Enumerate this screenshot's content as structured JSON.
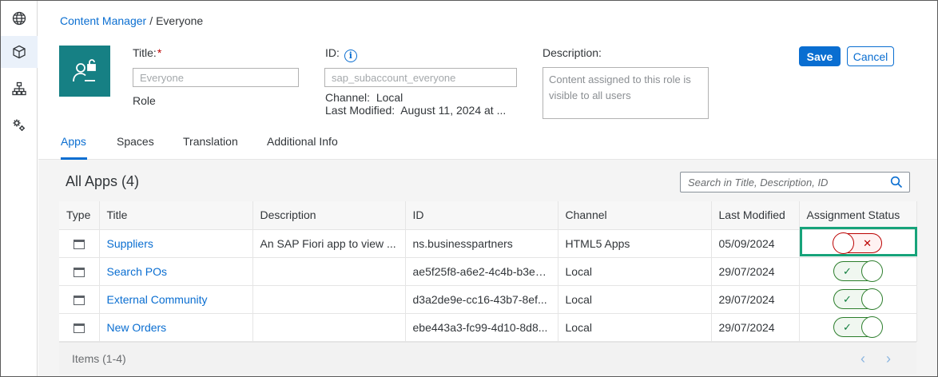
{
  "breadcrumb": {
    "parent": "Content Manager",
    "separator": "/",
    "current": "Everyone"
  },
  "header": {
    "title_label": "Title:",
    "required_mark": "*",
    "title_value": "Everyone",
    "role_label": "Role",
    "id_label": "ID:",
    "id_value": "sap_subaccount_everyone",
    "channel_label": "Channel:",
    "channel_value": "Local",
    "last_modified_label": "Last Modified:",
    "last_modified_value": "August 11, 2024 at ...",
    "description_label": "Description:",
    "description_value": "Content assigned to this role is visible to all users",
    "save_label": "Save",
    "cancel_label": "Cancel"
  },
  "tabs": [
    {
      "label": "Apps",
      "active": true
    },
    {
      "label": "Spaces"
    },
    {
      "label": "Translation"
    },
    {
      "label": "Additional Info"
    }
  ],
  "apps": {
    "title": "All Apps (4)",
    "search_placeholder": "Search in Title, Description, ID",
    "columns": [
      "Type",
      "Title",
      "Description",
      "ID",
      "Channel",
      "Last Modified",
      "Assignment Status"
    ],
    "rows": [
      {
        "title": "Suppliers",
        "description": "An SAP Fiori app to view ...",
        "id": "ns.businesspartners",
        "channel": "HTML5 Apps",
        "last_modified": "05/09/2024",
        "assigned": false
      },
      {
        "title": "Search POs",
        "description": "",
        "id": "ae5f25f8-a6e2-4c4b-b3e5...",
        "channel": "Local",
        "last_modified": "29/07/2024",
        "assigned": true
      },
      {
        "title": "External Community",
        "description": "",
        "id": "d3a2de9e-cc16-43b7-8ef...",
        "channel": "Local",
        "last_modified": "29/07/2024",
        "assigned": true
      },
      {
        "title": "New Orders",
        "description": "",
        "id": "ebe443a3-fc99-4d10-8d8...",
        "channel": "Local",
        "last_modified": "29/07/2024",
        "assigned": true
      }
    ],
    "footer_text": "Items (1-4)"
  },
  "colors": {
    "accent": "#0a6ed1",
    "tile": "#168084",
    "on": "#107e3e",
    "off": "#bb0000",
    "highlight": "#17a37a"
  },
  "icons": {
    "nav": [
      "globe-icon",
      "cube-icon",
      "sitemap-icon",
      "gears-icon"
    ],
    "tile": "user-unlock-icon"
  }
}
